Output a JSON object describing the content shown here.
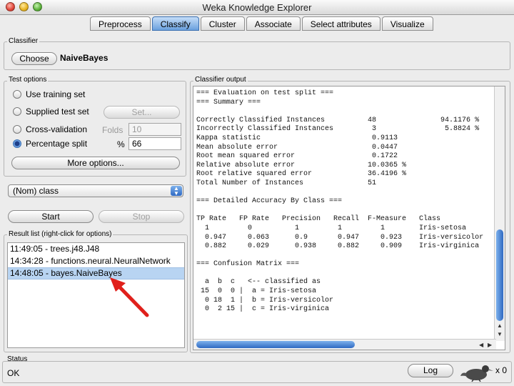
{
  "window": {
    "title": "Weka Knowledge Explorer"
  },
  "tabs": [
    {
      "label": "Preprocess",
      "active": false
    },
    {
      "label": "Classify",
      "active": true
    },
    {
      "label": "Cluster",
      "active": false
    },
    {
      "label": "Associate",
      "active": false
    },
    {
      "label": "Select attributes",
      "active": false
    },
    {
      "label": "Visualize",
      "active": false
    }
  ],
  "classifier": {
    "group_label": "Classifier",
    "choose_label": "Choose",
    "name": "NaiveBayes"
  },
  "test_options": {
    "group_label": "Test options",
    "use_training_set": "Use training set",
    "supplied_test_set": "Supplied test set",
    "set_button": "Set...",
    "cross_validation": "Cross-validation",
    "folds_label": "Folds",
    "folds_value": "10",
    "percentage_split": "Percentage split",
    "percent_label": "%",
    "percent_value": "66",
    "selected": "percentage_split",
    "more_options": "More options..."
  },
  "class_select": {
    "value": "(Nom) class"
  },
  "actions": {
    "start": "Start",
    "stop": "Stop"
  },
  "result_list": {
    "group_label": "Result list (right-click for options)",
    "items": [
      "11:49:05 - trees.j48.J48",
      "14:34:28 - functions.neural.NeuralNetwork",
      "14:48:05 - bayes.NaiveBayes"
    ],
    "selected_index": 2
  },
  "output": {
    "group_label": "Classifier output",
    "text": "=== Evaluation on test split ===\n=== Summary ===\n\nCorrectly Classified Instances          48               94.1176 %\nIncorrectly Classified Instances         3                5.8824 %\nKappa statistic                          0.9113\nMean absolute error                      0.0447\nRoot mean squared error                  0.1722\nRelative absolute error                 10.0365 %\nRoot relative squared error             36.4196 %\nTotal Number of Instances               51\n\n=== Detailed Accuracy By Class ===\n\nTP Rate   FP Rate   Precision   Recall  F-Measure   Class\n  1         0          1         1         1        Iris-setosa\n  0.947     0.063      0.9       0.947     0.923    Iris-versicolor\n  0.882     0.029      0.938     0.882     0.909    Iris-virginica\n\n=== Confusion Matrix ===\n\n  a  b  c   <-- classified as\n 15  0  0 |  a = Iris-setosa\n  0 18  1 |  b = Iris-versicolor\n  0  2 15 |  c = Iris-virginica"
  },
  "status": {
    "group_label": "Status",
    "text": "OK",
    "log_button": "Log",
    "count": "x 0"
  },
  "colors": {
    "accent": "#6aa0de",
    "selection": "#b8d4f2",
    "annotation_arrow": "#e0201b"
  },
  "icons": {
    "status_animal": "weka-bird-icon",
    "annotation": "red-arrow-icon"
  }
}
